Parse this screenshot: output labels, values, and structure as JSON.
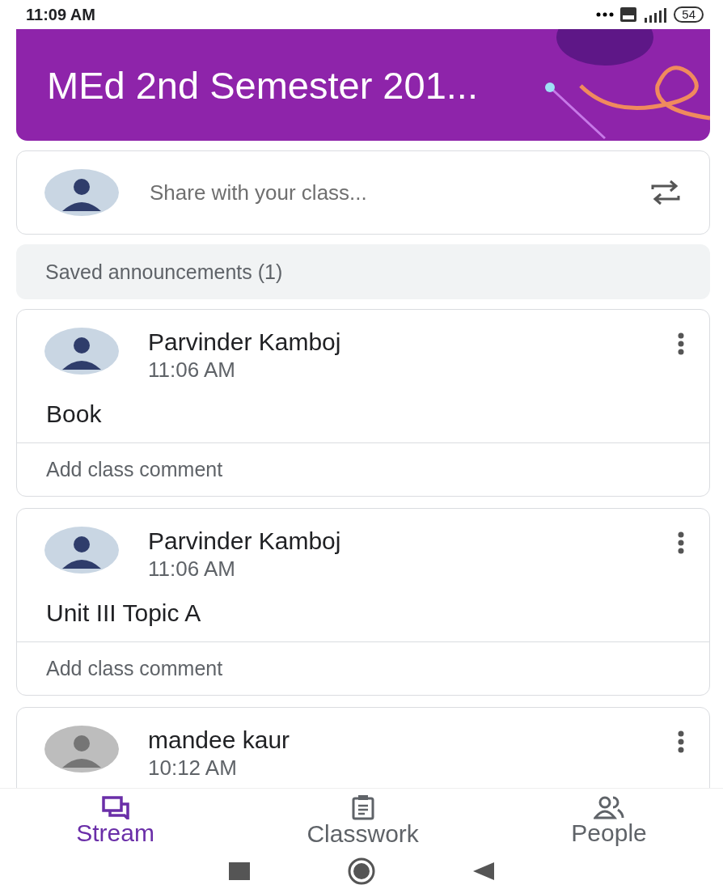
{
  "status_bar": {
    "time": "11:09 AM",
    "battery": "54"
  },
  "header": {
    "title": "MEd 2nd Semester 201..."
  },
  "composer": {
    "placeholder": "Share with your class..."
  },
  "saved": {
    "label": "Saved announcements (1)"
  },
  "posts": [
    {
      "author": "Parvinder Kamboj",
      "time": "11:06 AM",
      "kind": "photo",
      "body": "Book",
      "comment": "Add class comment"
    },
    {
      "author": "Parvinder Kamboj",
      "time": "11:06 AM",
      "kind": "photo",
      "body": "Unit III Topic A",
      "comment": "Add class comment"
    },
    {
      "author": "mandee kaur",
      "time": "10:12 AM",
      "kind": "default"
    }
  ],
  "tabs": [
    {
      "label": "Stream",
      "selected": true,
      "kind": "stream"
    },
    {
      "label": "Classwork",
      "selected": false,
      "kind": "classwork"
    },
    {
      "label": "People",
      "selected": false,
      "kind": "people"
    }
  ]
}
